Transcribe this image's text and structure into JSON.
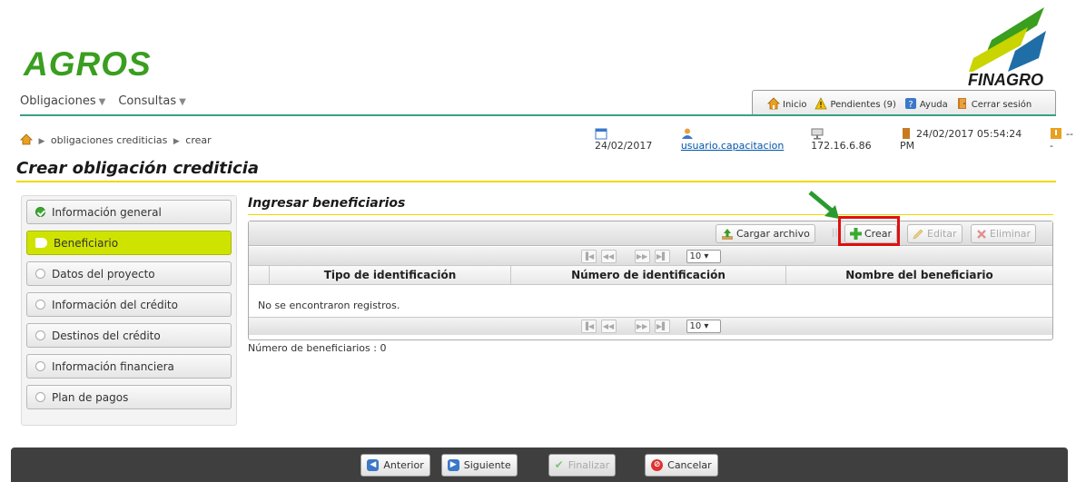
{
  "header": {
    "app_logo": "AGROS",
    "brand_logo": "FINAGRO",
    "menu": [
      {
        "label": "Obligaciones"
      },
      {
        "label": "Consultas"
      }
    ],
    "toplinks": {
      "home": "Inicio",
      "pending": "Pendientes (9)",
      "help": "Ayuda",
      "logout": "Cerrar sesión"
    }
  },
  "breadcrumb": {
    "items": [
      "obligaciones crediticias",
      "crear"
    ]
  },
  "status": {
    "date": "24/02/2017",
    "user": "usuario.capacitacion",
    "ip": "172.16.6.86",
    "datetime": "24/02/2017 05:54:24 PM",
    "extra": "---"
  },
  "page_title": "Crear obligación crediticia",
  "steps": [
    {
      "label": "Información general",
      "state": "done"
    },
    {
      "label": "Beneficiario",
      "state": "active"
    },
    {
      "label": "Datos del proyecto",
      "state": "pending"
    },
    {
      "label": "Información del crédito",
      "state": "pending"
    },
    {
      "label": "Destinos del crédito",
      "state": "pending"
    },
    {
      "label": "Información financiera",
      "state": "pending"
    },
    {
      "label": "Plan de pagos",
      "state": "pending"
    }
  ],
  "section_title": "Ingresar beneficiarios",
  "grid": {
    "toolbar": {
      "upload": "Cargar archivo",
      "create": "Crear",
      "edit": "Editar",
      "delete": "Eliminar"
    },
    "page_size": "10 ▾",
    "columns": [
      "Tipo de identificación",
      "Número de identificación",
      "Nombre del beneficiario"
    ],
    "empty_message": "No se encontraron registros."
  },
  "count_text": "Número de beneficiarios : 0",
  "footer": {
    "prev": "Anterior",
    "next": "Siguiente",
    "finish": "Finalizar",
    "cancel": "Cancelar"
  },
  "colors": {
    "brand_green": "#3a9e1f",
    "active_step": "#cfe300",
    "accent_line": "#f0d800",
    "highlight": "#e01010"
  }
}
